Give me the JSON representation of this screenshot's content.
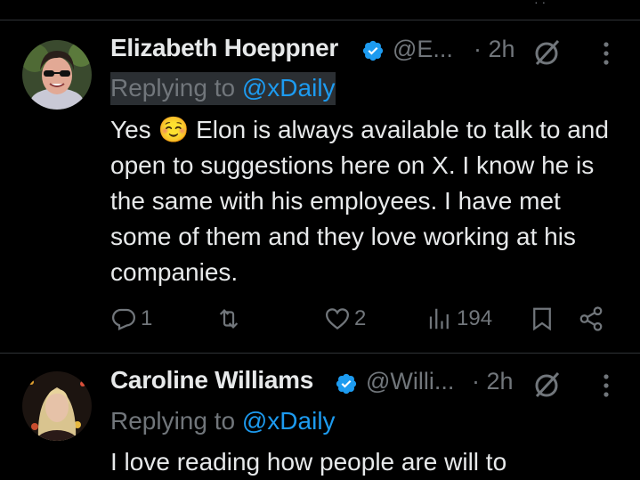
{
  "tweets": [
    {
      "author": "Elizabeth Hoeppner",
      "handle": "@E...",
      "time": "· 2h",
      "replying_prefix": "Replying to ",
      "replying_to": "@xDaily",
      "body_before_emoji": "Yes ",
      "emoji": "☺️",
      "body_after_emoji": " Elon is always available to talk to and open to suggestions here on X. I know he is the same with his employees. I have met some of them and they love working at his companies.",
      "replies": "1",
      "reposts": "",
      "likes": "2",
      "views": "194"
    },
    {
      "author": "Caroline Williams",
      "handle": "@Willi...",
      "time": "· 2h",
      "replying_prefix": "Replying to ",
      "replying_to": "@xDaily",
      "body": "I love reading how people are will to"
    }
  ],
  "icons": {
    "verified": "verified-badge-icon",
    "grok": "grok-icon",
    "more": "more-dots-icon",
    "reply": "reply-icon",
    "repost": "repost-icon",
    "like": "heart-icon",
    "views": "views-icon",
    "bookmark": "bookmark-icon",
    "share": "share-icon"
  },
  "colors": {
    "background": "#000000",
    "text": "#e7e9ea",
    "muted": "#71767b",
    "accent": "#1d9bf0",
    "divider": "#2f3336"
  }
}
